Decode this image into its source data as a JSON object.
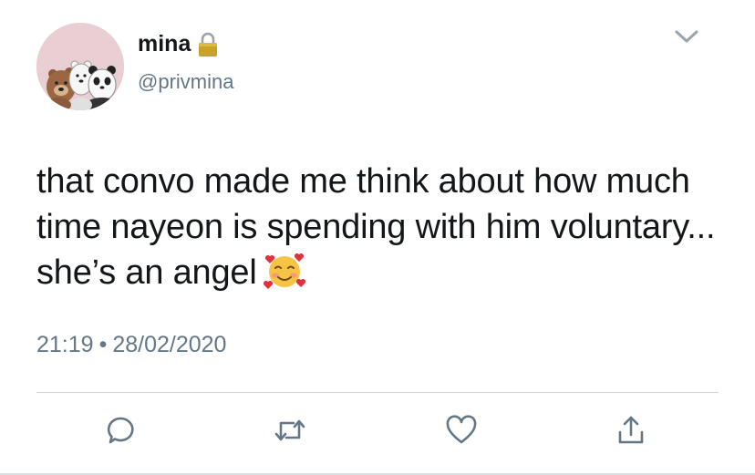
{
  "tweet": {
    "display_name": "mina",
    "handle": "@privmina",
    "text": "that convo made me think about how much time nayeon is spending with him voluntary... she’s an angel",
    "emoji": "smiling-face-with-hearts",
    "time": "21:19",
    "separator": "•",
    "date": "28/02/2020"
  },
  "icons": {
    "lock": "lock-icon",
    "menu": "chevron-down-icon",
    "reply": "reply-icon",
    "retweet": "retweet-icon",
    "like": "heart-icon",
    "share": "share-icon"
  },
  "colors": {
    "text": "#14171a",
    "secondary": "#657786",
    "icon": "#657786",
    "avatar_bg": "#e9cfd3",
    "divider": "#cfd6db"
  }
}
